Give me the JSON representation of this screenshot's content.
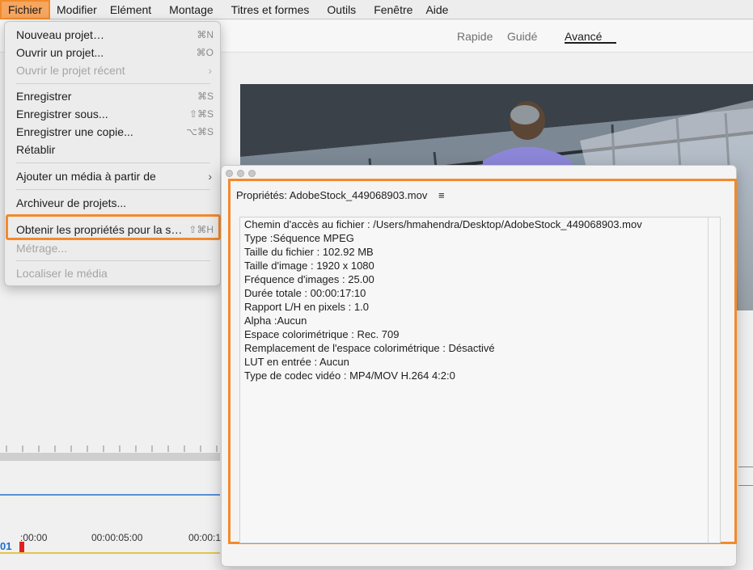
{
  "menubar": {
    "items": [
      "Fichier",
      "Modifier",
      "Elément",
      "Montage",
      "Titres et formes",
      "Outils",
      "Fenêtre",
      "Aide"
    ]
  },
  "workspace": {
    "tabs": [
      "Rapide",
      "Guidé",
      "Avancé"
    ],
    "active": "Avancé"
  },
  "file_menu": {
    "items": [
      {
        "label": "Nouveau projet…",
        "shortcut": "⌘N",
        "enabled": true
      },
      {
        "label": "Ouvrir un projet...",
        "shortcut": "⌘O",
        "enabled": true
      },
      {
        "label": "Ouvrir le projet récent",
        "submenu": true,
        "enabled": false
      },
      {
        "label": "Enregistrer",
        "shortcut": "⌘S",
        "enabled": true
      },
      {
        "label": "Enregistrer sous...",
        "shortcut": "⇧⌘S",
        "enabled": true
      },
      {
        "label": "Enregistrer une copie...",
        "shortcut": "⌥⌘S",
        "enabled": true
      },
      {
        "label": "Rétablir",
        "enabled": true
      },
      {
        "label": "Ajouter un média à partir de",
        "submenu": true,
        "enabled": true
      },
      {
        "label": "Archiveur de projets...",
        "enabled": true
      },
      {
        "label": "Obtenir les propriétés pour la s…",
        "shortcut": "⇧⌘H",
        "enabled": true,
        "highlighted": true
      },
      {
        "label": "Métrage...",
        "enabled": false
      },
      {
        "label": "Localiser le média",
        "enabled": false
      }
    ]
  },
  "properties": {
    "title": "Propriétés: AdobeStock_449068903.mov",
    "menu_icon": "hamburger-icon",
    "lines": [
      "Chemin d'accès au fichier :  /Users/hmahendra/Desktop/AdobeStock_449068903.mov",
      "Type :Séquence MPEG",
      "Taille du fichier :  102.92 MB",
      "Taille d'image :  1920 x 1080",
      "Fréquence d'images : 25.00",
      "Durée totale :  00:00:17:10",
      "Rapport L/H en pixels :  1.0",
      "Alpha :Aucun",
      "Espace colorimétrique :  Rec. 709",
      "Remplacement de l'espace colorimétrique :  Désactivé",
      "LUT en entrée :  Aucun",
      "Type de codec vidéo :  MP4/MOV H.264 4:2:0"
    ]
  },
  "timeline": {
    "playhead_label": "01",
    "timecodes": [
      ":00:00",
      "00:00:05:00",
      "00:00:1"
    ]
  },
  "colors": {
    "highlight": "#f28a2c",
    "timecode_blue": "#1e6ed1",
    "playhead_red": "#dd2222"
  }
}
